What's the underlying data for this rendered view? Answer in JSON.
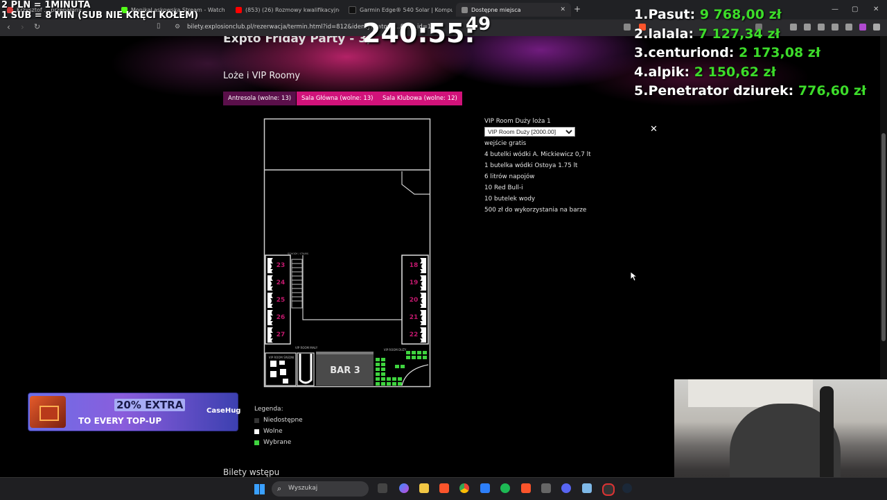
{
  "overlay": {
    "sub_line1": "2 PLN = 1MINUTA",
    "sub_line2": "1 SUB = 8 MIN (SUB NIE KRĘCI KOŁEM)",
    "timer": "240:55:",
    "timer_extra": "49"
  },
  "browser": {
    "tabs": [
      {
        "label": "Krzysztof ... przepałany",
        "color": "#d43b3b"
      },
      {
        "label": "MonikaLaskowska Stream - Watch Li",
        "color": "#53fc18"
      },
      {
        "label": "(853) (26) Rozmowy kwalifikacyjne pi",
        "color": "#ff0000"
      },
      {
        "label": "Garmin Edge® 540 Solar | Komputer",
        "color": "#111111"
      },
      {
        "label": "Dostępne miejsca",
        "color": "#888888"
      }
    ],
    "url": "bilety.explosionclub.pl/rezerwacja/termin.html?id=812&identyfikator=...&wiz_id=11"
  },
  "page": {
    "event_title": "Expto Friday Party - 3,",
    "section_title": "Loże i VIP Roomy",
    "hall_tabs": [
      {
        "label": "Antresola (wolne: 13)",
        "active": true
      },
      {
        "label": "Sala Główna (wolne: 13)",
        "active": false
      },
      {
        "label": "Sala Klubowa (wolne: 12)",
        "active": false
      }
    ],
    "selected": {
      "title": "VIP Room Duży loża 1",
      "select_value": "VIP Room Duży  [2000.00]",
      "items": [
        "wejście gratis",
        "4 butelki wódki A. Mickiewicz 0,7 lt",
        "1 butelka wódki Ostoya 1.75 lt",
        "6 litrów napojów",
        "10 Red Bull-i",
        "10 butelek wody",
        "500 zł do wykorzystania na barze"
      ]
    },
    "close_symbol": "✕",
    "map": {
      "left_booths": [
        "23",
        "24",
        "25",
        "26",
        "27"
      ],
      "right_booths": [
        "18",
        "19",
        "20",
        "21",
        "22"
      ],
      "bar_label": "BAR 3",
      "vip_small_label": "VIP ROOM MAŁY",
      "vip_medium_label": "VIP ROOM ŚREDNI",
      "vip_large_label": "VIP ROOM DUŻY",
      "stairs_label": "SCHODY / STAIRS",
      "booth_color": "#c0186c",
      "selected_color": "#3fd43f"
    },
    "legend": {
      "title": "Legenda:",
      "items": [
        {
          "label": "Niedostępne",
          "color": "#333333"
        },
        {
          "label": "Wolne",
          "color": "#ffffff"
        },
        {
          "label": "Wybrane",
          "color": "#3fd43f"
        }
      ]
    },
    "tickets_title": "Bilety wstępu"
  },
  "leaderboard": [
    {
      "rank": "1.",
      "name": "Pasut:",
      "amount": "9 768,00 zł"
    },
    {
      "rank": "2.",
      "name": "lalala:",
      "amount": "7 127,34 zł"
    },
    {
      "rank": "3.",
      "name": "centuriond:",
      "amount": "2 173,08 zł"
    },
    {
      "rank": "4.",
      "name": "alpik:",
      "amount": "2 150,62 zł"
    },
    {
      "rank": "5.",
      "name": "Penetrator dziurek:",
      "amount": "776,60 zł"
    }
  ],
  "promo": {
    "big": "20% EXTRA",
    "small": "TO EVERY TOP-UP",
    "brand": "CaseHug"
  },
  "taskbar": {
    "search_placeholder": "Wyszukaj",
    "icons": [
      "file-manager",
      "copilot",
      "folder",
      "brave",
      "chrome",
      "store",
      "spotify",
      "brave-beta",
      "calculator",
      "discord",
      "notepad",
      "recorder",
      "steam"
    ]
  }
}
